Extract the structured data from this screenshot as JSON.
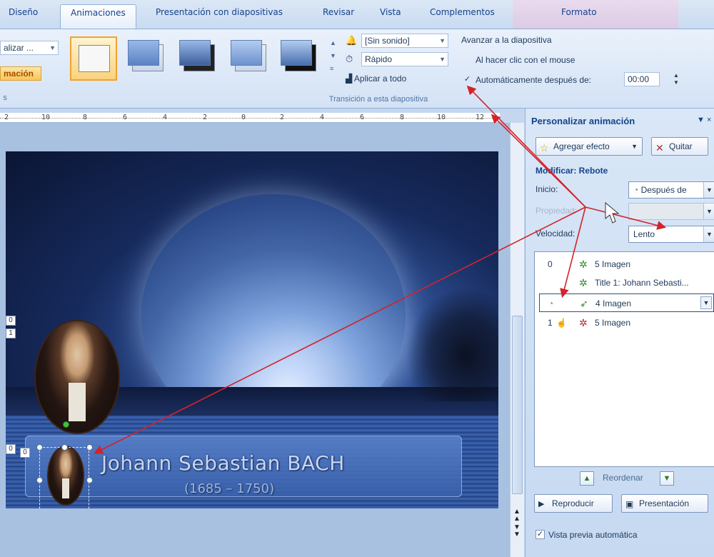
{
  "tabs": {
    "diseno": "Diseño",
    "animaciones": "Animaciones",
    "presentacion": "Presentación con diapositivas",
    "revisar": "Revisar",
    "vista": "Vista",
    "complementos": "Complementos",
    "formato": "Formato"
  },
  "ribbon": {
    "animate_dropdown": "alizar ...",
    "animation_btn": "mación",
    "sound": "[Sin sonido]",
    "speed": "Rápido",
    "apply_all": "Aplicar a todo",
    "group_label": "Transición a esta diapositiva",
    "advance_title": "Avanzar a la diapositiva",
    "on_click": "Al hacer clic con el mouse",
    "auto_after": "Automáticamente después de:",
    "time": "00:00",
    "colors": {
      "selected_border": "#f0a232",
      "accent": "#15428b"
    }
  },
  "ruler": {
    "labels": [
      "2",
      "10",
      "8",
      "6",
      "4",
      "2",
      "0",
      "2",
      "4",
      "6",
      "8",
      "10",
      "12"
    ]
  },
  "slide": {
    "title": "Johann Sebastian BACH",
    "subtitle": "(1685 – 1750)",
    "tags": [
      "0",
      "1",
      "0",
      "0"
    ]
  },
  "pane": {
    "title": "Personalizar animación",
    "add_effect": "Agregar efecto",
    "remove": "Quitar",
    "modify": "Modificar: Rebote",
    "start_label": "Inicio:",
    "start_value": "Después de",
    "property_label": "Propiedad:",
    "speed_label": "Velocidad:",
    "speed_value": "Lento",
    "items": [
      {
        "num": "0",
        "label": "5 Imagen"
      },
      {
        "num": "",
        "label": "Title 1: Johann Sebasti..."
      },
      {
        "num": "",
        "label": "4 Imagen"
      },
      {
        "num": "1",
        "label": "5 Imagen"
      }
    ],
    "reorder": "Reordenar",
    "play": "Reproducir",
    "slideshow": "Presentación",
    "autopreview": "Vista previa automática"
  }
}
